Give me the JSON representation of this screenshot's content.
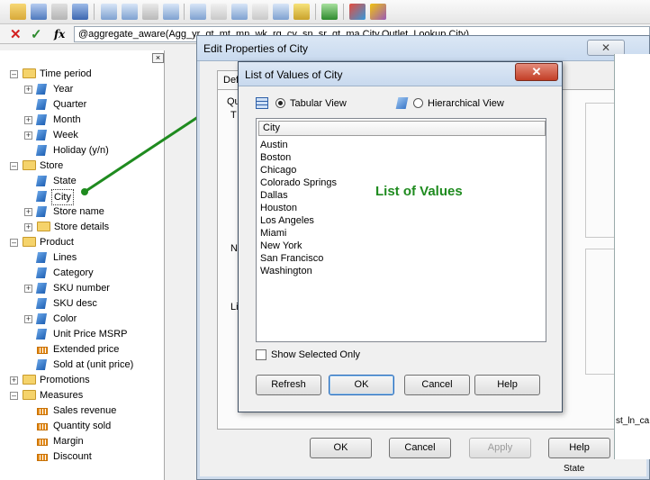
{
  "toolbar": {
    "icons": [
      "open-folder-icon",
      "save-arrow-icon",
      "filter-icon",
      "database-icon",
      "new-report-icon",
      "tree-icon",
      "table-icon",
      "hierarchy-icon",
      "format-number-icon",
      "sum-icon",
      "export-icon",
      "settings-icon",
      "key-icon",
      "checkmark-icon",
      "grid-color-icon",
      "chart-color-icon"
    ]
  },
  "formula": {
    "fx": "fx",
    "text": "@aggregate_aware(Agg_yr_qt_mt_mn_wk_rg_cy_sn_sr_qt_ma.City,Outlet_Lookup.City)"
  },
  "tree": {
    "items": [
      {
        "label": "Time period",
        "type": "folder",
        "level": 0,
        "expander": "−"
      },
      {
        "label": "Year",
        "type": "dim",
        "level": 1,
        "expander": "+"
      },
      {
        "label": "Quarter",
        "type": "dim",
        "level": 1,
        "expander": ""
      },
      {
        "label": "Month",
        "type": "dim",
        "level": 1,
        "expander": "+"
      },
      {
        "label": "Week",
        "type": "dim",
        "level": 1,
        "expander": "+"
      },
      {
        "label": "Holiday (y/n)",
        "type": "dim",
        "level": 1,
        "expander": ""
      },
      {
        "label": "Store",
        "type": "folder",
        "level": 0,
        "expander": "−"
      },
      {
        "label": "State",
        "type": "dim",
        "level": 1,
        "expander": ""
      },
      {
        "label": "City",
        "type": "dim",
        "level": 1,
        "expander": "",
        "selected": true
      },
      {
        "label": "Store name",
        "type": "dim",
        "level": 1,
        "expander": "+"
      },
      {
        "label": "Store details",
        "type": "folder",
        "level": 1,
        "expander": "+"
      },
      {
        "label": "Product",
        "type": "folder",
        "level": 0,
        "expander": "−"
      },
      {
        "label": "Lines",
        "type": "dim",
        "level": 1,
        "expander": ""
      },
      {
        "label": "Category",
        "type": "dim",
        "level": 1,
        "expander": ""
      },
      {
        "label": "SKU number",
        "type": "dim",
        "level": 1,
        "expander": "+"
      },
      {
        "label": "SKU desc",
        "type": "dim",
        "level": 1,
        "expander": ""
      },
      {
        "label": "Color",
        "type": "dim",
        "level": 1,
        "expander": "+"
      },
      {
        "label": "Unit Price MSRP",
        "type": "dim",
        "level": 1,
        "expander": ""
      },
      {
        "label": "Extended price",
        "type": "measure",
        "level": 1,
        "expander": ""
      },
      {
        "label": "Sold at (unit price)",
        "type": "dim",
        "level": 1,
        "expander": ""
      },
      {
        "label": "Promotions",
        "type": "folder",
        "level": 0,
        "expander": "+"
      },
      {
        "label": "Measures",
        "type": "folder",
        "level": 0,
        "expander": "−"
      },
      {
        "label": "Sales revenue",
        "type": "measure",
        "level": 1,
        "expander": ""
      },
      {
        "label": "Quantity sold",
        "type": "measure",
        "level": 1,
        "expander": ""
      },
      {
        "label": "Margin",
        "type": "measure",
        "level": 1,
        "expander": ""
      },
      {
        "label": "Discount",
        "type": "measure",
        "level": 1,
        "expander": ""
      }
    ]
  },
  "edit_dialog": {
    "title": "Edit Properties of City",
    "close": "✕",
    "tabs": [
      "Defi"
    ],
    "partial_labels": {
      "q": "Qu",
      "t": "T",
      "n": "N",
      "li": "Li"
    },
    "buttons": {
      "ok": "OK",
      "cancel": "Cancel",
      "apply": "Apply",
      "help": "Help"
    }
  },
  "lov_dialog": {
    "title": "List of Values of City",
    "close": "✕",
    "views": {
      "tabular": "Tabular View",
      "hierarchical": "Hierarchical View"
    },
    "column_header": "City",
    "values": [
      "Austin",
      "Boston",
      "Chicago",
      "Colorado Springs",
      "Dallas",
      "Houston",
      "Los Angeles",
      "Miami",
      "New York",
      "San Francisco",
      "Washington"
    ],
    "show_selected_only": "Show Selected Only",
    "buttons": {
      "refresh": "Refresh",
      "ok": "OK",
      "cancel": "Cancel",
      "help": "Help"
    }
  },
  "annotation": {
    "text": "List of Values",
    "color": "#1f8b1f"
  },
  "background_fragments": {
    "right_label": "st_ln_ca",
    "state": "State"
  }
}
